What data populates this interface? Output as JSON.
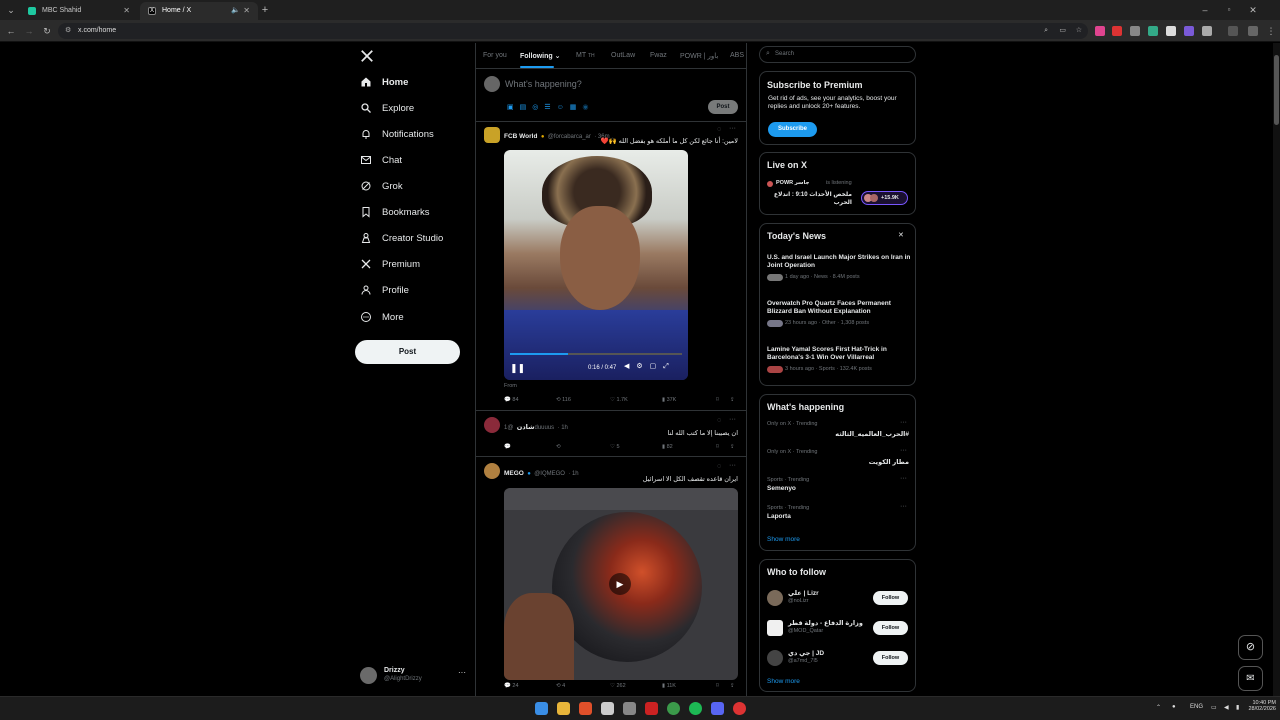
{
  "browser": {
    "tabs": [
      {
        "title": "MBC Shahid",
        "active": false
      },
      {
        "title": "Home / X",
        "active": true
      }
    ],
    "url": "x.com/home"
  },
  "sidebar": {
    "items": [
      {
        "label": "Home",
        "icon": "home-icon"
      },
      {
        "label": "Explore",
        "icon": "search-icon"
      },
      {
        "label": "Notifications",
        "icon": "bell-icon"
      },
      {
        "label": "Chat",
        "icon": "mail-icon"
      },
      {
        "label": "Grok",
        "icon": "grok-icon"
      },
      {
        "label": "Bookmarks",
        "icon": "bookmark-icon"
      },
      {
        "label": "Creator Studio",
        "icon": "creator-icon"
      },
      {
        "label": "Premium",
        "icon": "x-logo-icon"
      },
      {
        "label": "Profile",
        "icon": "person-icon"
      },
      {
        "label": "More",
        "icon": "more-circle-icon"
      }
    ],
    "post_label": "Post",
    "account": {
      "name": "Drizzy",
      "handle": "@AlightDrizzy"
    }
  },
  "feed": {
    "tabs": [
      "For you",
      "Following",
      "MT",
      "OutLaw",
      "Fwaz",
      "POWR | باور",
      "ABS"
    ],
    "tab_badge": "TH",
    "compose_placeholder": "What's happening?",
    "compose_post": "Post",
    "tweets": [
      {
        "name": "FCB World",
        "handle": "@forcabarca_ar",
        "time": "· 36m",
        "text": "لامين: أنا جائع لكن كل ما أملكه هو بفضل الله 🙌❤️",
        "video_time": "0:16 / 0:47",
        "from": "From",
        "replies": "84",
        "reposts": "116",
        "likes": "1.7K",
        "views": "37K"
      },
      {
        "name": "شادن",
        "handle": "@1duuuus",
        "time": "· 1h",
        "text": "ان يصيبنا إلا ما كتب الله لنا",
        "likes": "5",
        "views": "82"
      },
      {
        "name": "MEGO",
        "handle": "@IQMEGO",
        "time": "· 1h",
        "text": "ايران قاعده تقصف الكل الا اسرائيل",
        "replies": "24",
        "reposts": "4",
        "likes": "262",
        "views": "11K"
      }
    ]
  },
  "right": {
    "search_placeholder": "Search",
    "premium": {
      "title": "Subscribe to Premium",
      "body": "Get rid of ads, see your analytics, boost your replies and unlock 20+ features.",
      "button": "Subscribe"
    },
    "live": {
      "title": "Live on X",
      "host": "POWR جاسر",
      "status": "is listening",
      "topic": "ملخص الأحداث 9:10 : اندلاع الحرب",
      "count": "+15.9K"
    },
    "news": {
      "title": "Today's News",
      "close": "✕",
      "items": [
        {
          "headline": "U.S. and Israel Launch Major Strikes on Iran in Joint Operation",
          "meta": "1 day ago · News · 8.4M posts"
        },
        {
          "headline": "Overwatch Pro Quartz Faces Permanent Blizzard Ban Without Explanation",
          "meta": "23 hours ago · Other · 1,308 posts"
        },
        {
          "headline": "Lamine Yamal Scores First Hat-Trick in Barcelona's 3-1 Win Over Villarreal",
          "meta": "3 hours ago · Sports · 132.4K posts"
        }
      ]
    },
    "happening": {
      "title": "What's happening",
      "items": [
        {
          "context": "Only on X · Trending",
          "topic": "#الحرب_العالميه_الثالثه"
        },
        {
          "context": "Only on X · Trending",
          "topic": "مطار الكويت"
        },
        {
          "context": "Sports · Trending",
          "topic": "Semenyo"
        },
        {
          "context": "Sports · Trending",
          "topic": "Laporta"
        }
      ],
      "show_more": "Show more"
    },
    "follow": {
      "title": "Who to follow",
      "items": [
        {
          "name": "علي | Lizr",
          "handle": "@noLizr",
          "button": "Follow"
        },
        {
          "name": "وزارة الدفاع - دولة قطر",
          "handle": "@MOD_Qatar",
          "button": "Follow"
        },
        {
          "name": "جي دي | JD",
          "handle": "@a7md_7l5",
          "button": "Follow"
        }
      ],
      "show_more": "Show more"
    }
  },
  "taskbar": {
    "lang": "ENG",
    "time": "10:40 PM",
    "date": "28/02/2026"
  },
  "colors": {
    "accent": "#1d9bf0",
    "background": "#000000",
    "border": "#2f3336"
  }
}
